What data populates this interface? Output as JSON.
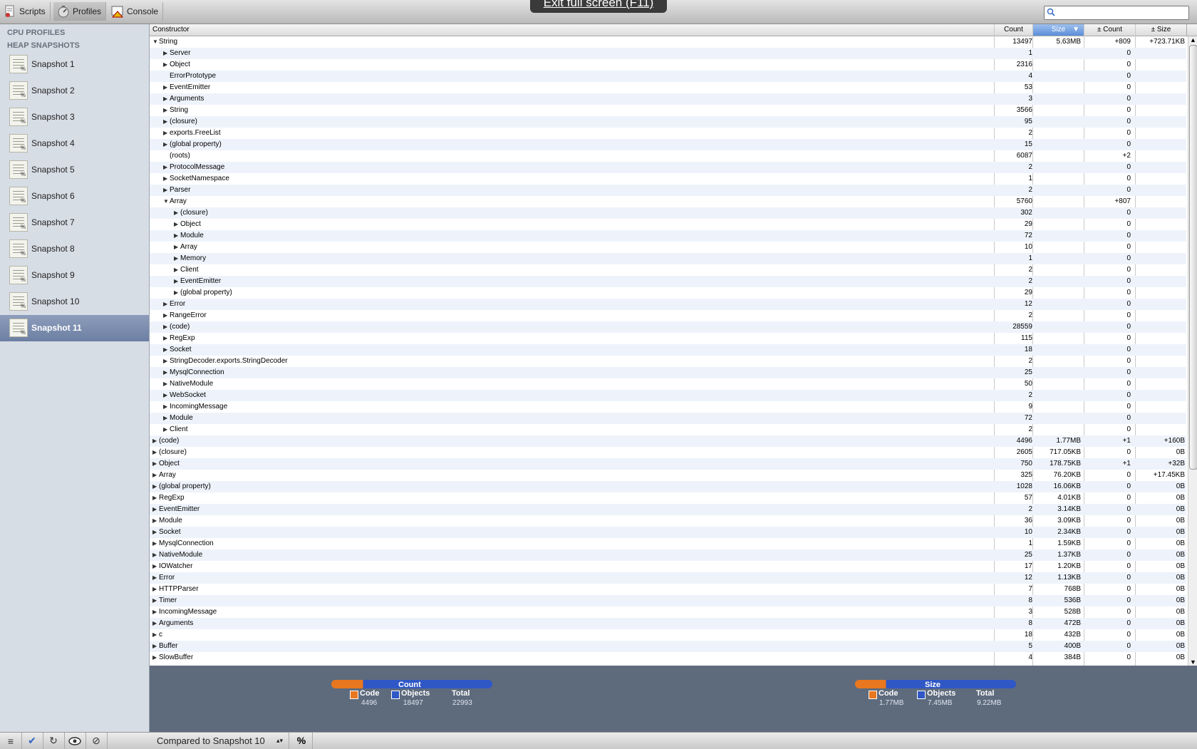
{
  "toolbar": {
    "scripts_label": "Scripts",
    "profiles_label": "Profiles",
    "console_label": "Console",
    "fullscreen_banner": "Exit full screen (F11)",
    "search_value": ""
  },
  "sidebar": {
    "cpu_header": "CPU PROFILES",
    "heap_header": "HEAP SNAPSHOTS",
    "snapshots": [
      "Snapshot 1",
      "Snapshot 2",
      "Snapshot 3",
      "Snapshot 4",
      "Snapshot 5",
      "Snapshot 6",
      "Snapshot 7",
      "Snapshot 8",
      "Snapshot 9",
      "Snapshot 10",
      "Snapshot 11"
    ],
    "selected_snapshot": "Snapshot 11"
  },
  "grid": {
    "columns": [
      "Constructor",
      "Count",
      "Size",
      "± Count",
      "± Size"
    ],
    "sorted_column": "Size",
    "rows": [
      {
        "name": "String",
        "indent": 0,
        "tri": "down",
        "count": "13497",
        "size": "5.63MB",
        "dcount": "+809",
        "dsize": "+723.71KB"
      },
      {
        "name": "Server",
        "indent": 1,
        "tri": "right",
        "count": "1",
        "size": "",
        "dcount": "0",
        "dsize": ""
      },
      {
        "name": "Object",
        "indent": 1,
        "tri": "right",
        "count": "2316",
        "size": "",
        "dcount": "0",
        "dsize": ""
      },
      {
        "name": "ErrorPrototype",
        "indent": 1,
        "tri": "",
        "count": "4",
        "size": "",
        "dcount": "0",
        "dsize": ""
      },
      {
        "name": "EventEmitter",
        "indent": 1,
        "tri": "right",
        "count": "53",
        "size": "",
        "dcount": "0",
        "dsize": ""
      },
      {
        "name": "Arguments",
        "indent": 1,
        "tri": "right",
        "count": "3",
        "size": "",
        "dcount": "0",
        "dsize": ""
      },
      {
        "name": "String",
        "indent": 1,
        "tri": "right",
        "count": "3566",
        "size": "",
        "dcount": "0",
        "dsize": ""
      },
      {
        "name": "(closure)",
        "indent": 1,
        "tri": "right",
        "count": "95",
        "size": "",
        "dcount": "0",
        "dsize": ""
      },
      {
        "name": "exports.FreeList",
        "indent": 1,
        "tri": "right",
        "count": "2",
        "size": "",
        "dcount": "0",
        "dsize": ""
      },
      {
        "name": "(global property)",
        "indent": 1,
        "tri": "right",
        "count": "15",
        "size": "",
        "dcount": "0",
        "dsize": ""
      },
      {
        "name": "(roots)",
        "indent": 1,
        "tri": "",
        "count": "6087",
        "size": "",
        "dcount": "+2",
        "dsize": ""
      },
      {
        "name": "ProtocolMessage",
        "indent": 1,
        "tri": "right",
        "count": "2",
        "size": "",
        "dcount": "0",
        "dsize": ""
      },
      {
        "name": "SocketNamespace",
        "indent": 1,
        "tri": "right",
        "count": "1",
        "size": "",
        "dcount": "0",
        "dsize": ""
      },
      {
        "name": "Parser",
        "indent": 1,
        "tri": "right",
        "count": "2",
        "size": "",
        "dcount": "0",
        "dsize": ""
      },
      {
        "name": "Array",
        "indent": 1,
        "tri": "down",
        "count": "5760",
        "size": "",
        "dcount": "+807",
        "dsize": ""
      },
      {
        "name": "(closure)",
        "indent": 2,
        "tri": "right",
        "count": "302",
        "size": "",
        "dcount": "0",
        "dsize": ""
      },
      {
        "name": "Object",
        "indent": 2,
        "tri": "right",
        "count": "29",
        "size": "",
        "dcount": "0",
        "dsize": ""
      },
      {
        "name": "Module",
        "indent": 2,
        "tri": "right",
        "count": "72",
        "size": "",
        "dcount": "0",
        "dsize": ""
      },
      {
        "name": "Array",
        "indent": 2,
        "tri": "right",
        "count": "10",
        "size": "",
        "dcount": "0",
        "dsize": ""
      },
      {
        "name": "Memory",
        "indent": 2,
        "tri": "right",
        "count": "1",
        "size": "",
        "dcount": "0",
        "dsize": ""
      },
      {
        "name": "Client",
        "indent": 2,
        "tri": "right",
        "count": "2",
        "size": "",
        "dcount": "0",
        "dsize": ""
      },
      {
        "name": "EventEmitter",
        "indent": 2,
        "tri": "right",
        "count": "2",
        "size": "",
        "dcount": "0",
        "dsize": ""
      },
      {
        "name": "(global property)",
        "indent": 2,
        "tri": "right",
        "count": "29",
        "size": "",
        "dcount": "0",
        "dsize": ""
      },
      {
        "name": "Error",
        "indent": 1,
        "tri": "right",
        "count": "12",
        "size": "",
        "dcount": "0",
        "dsize": ""
      },
      {
        "name": "RangeError",
        "indent": 1,
        "tri": "right",
        "count": "2",
        "size": "",
        "dcount": "0",
        "dsize": ""
      },
      {
        "name": "(code)",
        "indent": 1,
        "tri": "right",
        "count": "28559",
        "size": "",
        "dcount": "0",
        "dsize": ""
      },
      {
        "name": "RegExp",
        "indent": 1,
        "tri": "right",
        "count": "115",
        "size": "",
        "dcount": "0",
        "dsize": ""
      },
      {
        "name": "Socket",
        "indent": 1,
        "tri": "right",
        "count": "18",
        "size": "",
        "dcount": "0",
        "dsize": ""
      },
      {
        "name": "StringDecoder.exports.StringDecoder",
        "indent": 1,
        "tri": "right",
        "count": "2",
        "size": "",
        "dcount": "0",
        "dsize": ""
      },
      {
        "name": "MysqlConnection",
        "indent": 1,
        "tri": "right",
        "count": "25",
        "size": "",
        "dcount": "0",
        "dsize": ""
      },
      {
        "name": "NativeModule",
        "indent": 1,
        "tri": "right",
        "count": "50",
        "size": "",
        "dcount": "0",
        "dsize": ""
      },
      {
        "name": "WebSocket",
        "indent": 1,
        "tri": "right",
        "count": "2",
        "size": "",
        "dcount": "0",
        "dsize": ""
      },
      {
        "name": "IncomingMessage",
        "indent": 1,
        "tri": "right",
        "count": "9",
        "size": "",
        "dcount": "0",
        "dsize": ""
      },
      {
        "name": "Module",
        "indent": 1,
        "tri": "right",
        "count": "72",
        "size": "",
        "dcount": "0",
        "dsize": ""
      },
      {
        "name": "Client",
        "indent": 1,
        "tri": "right",
        "count": "2",
        "size": "",
        "dcount": "0",
        "dsize": ""
      },
      {
        "name": "(code)",
        "indent": 0,
        "tri": "right",
        "count": "4496",
        "size": "1.77MB",
        "dcount": "+1",
        "dsize": "+160B"
      },
      {
        "name": "(closure)",
        "indent": 0,
        "tri": "right",
        "count": "2605",
        "size": "717.05KB",
        "dcount": "0",
        "dsize": "0B"
      },
      {
        "name": "Object",
        "indent": 0,
        "tri": "right",
        "count": "750",
        "size": "178.75KB",
        "dcount": "+1",
        "dsize": "+32B"
      },
      {
        "name": "Array",
        "indent": 0,
        "tri": "right",
        "count": "325",
        "size": "76.20KB",
        "dcount": "0",
        "dsize": "+17.45KB"
      },
      {
        "name": "(global property)",
        "indent": 0,
        "tri": "right",
        "count": "1028",
        "size": "16.06KB",
        "dcount": "0",
        "dsize": "0B"
      },
      {
        "name": "RegExp",
        "indent": 0,
        "tri": "right",
        "count": "57",
        "size": "4.01KB",
        "dcount": "0",
        "dsize": "0B"
      },
      {
        "name": "EventEmitter",
        "indent": 0,
        "tri": "right",
        "count": "2",
        "size": "3.14KB",
        "dcount": "0",
        "dsize": "0B"
      },
      {
        "name": "Module",
        "indent": 0,
        "tri": "right",
        "count": "36",
        "size": "3.09KB",
        "dcount": "0",
        "dsize": "0B"
      },
      {
        "name": "Socket",
        "indent": 0,
        "tri": "right",
        "count": "10",
        "size": "2.34KB",
        "dcount": "0",
        "dsize": "0B"
      },
      {
        "name": "MysqlConnection",
        "indent": 0,
        "tri": "right",
        "count": "1",
        "size": "1.59KB",
        "dcount": "0",
        "dsize": "0B"
      },
      {
        "name": "NativeModule",
        "indent": 0,
        "tri": "right",
        "count": "25",
        "size": "1.37KB",
        "dcount": "0",
        "dsize": "0B"
      },
      {
        "name": "IOWatcher",
        "indent": 0,
        "tri": "right",
        "count": "17",
        "size": "1.20KB",
        "dcount": "0",
        "dsize": "0B"
      },
      {
        "name": "Error",
        "indent": 0,
        "tri": "right",
        "count": "12",
        "size": "1.13KB",
        "dcount": "0",
        "dsize": "0B"
      },
      {
        "name": "HTTPParser",
        "indent": 0,
        "tri": "right",
        "count": "7",
        "size": "768B",
        "dcount": "0",
        "dsize": "0B"
      },
      {
        "name": "Timer",
        "indent": 0,
        "tri": "right",
        "count": "8",
        "size": "536B",
        "dcount": "0",
        "dsize": "0B"
      },
      {
        "name": "IncomingMessage",
        "indent": 0,
        "tri": "right",
        "count": "3",
        "size": "528B",
        "dcount": "0",
        "dsize": "0B"
      },
      {
        "name": "Arguments",
        "indent": 0,
        "tri": "right",
        "count": "8",
        "size": "472B",
        "dcount": "0",
        "dsize": "0B"
      },
      {
        "name": "c",
        "indent": 0,
        "tri": "right",
        "count": "18",
        "size": "432B",
        "dcount": "0",
        "dsize": "0B"
      },
      {
        "name": "Buffer",
        "indent": 0,
        "tri": "right",
        "count": "5",
        "size": "400B",
        "dcount": "0",
        "dsize": "0B"
      },
      {
        "name": "SlowBuffer",
        "indent": 0,
        "tri": "right",
        "count": "4",
        "size": "384B",
        "dcount": "0",
        "dsize": "0B"
      }
    ]
  },
  "summary": {
    "count": {
      "title": "Count",
      "code_label": "Code",
      "code_value": "4496",
      "objects_label": "Objects",
      "objects_value": "18497",
      "total_label": "Total",
      "total_value": "22993",
      "code_fraction": 0.196
    },
    "size": {
      "title": "Size",
      "code_label": "Code",
      "code_value": "1.77MB",
      "objects_label": "Objects",
      "objects_value": "7.45MB",
      "total_label": "Total",
      "total_value": "9.22MB",
      "code_fraction": 0.192
    },
    "colors": {
      "code": "#e8771f",
      "objects": "#2f57c6"
    }
  },
  "statusbar": {
    "compare_label": "Compared to Snapshot 10",
    "percent_label": "%"
  }
}
